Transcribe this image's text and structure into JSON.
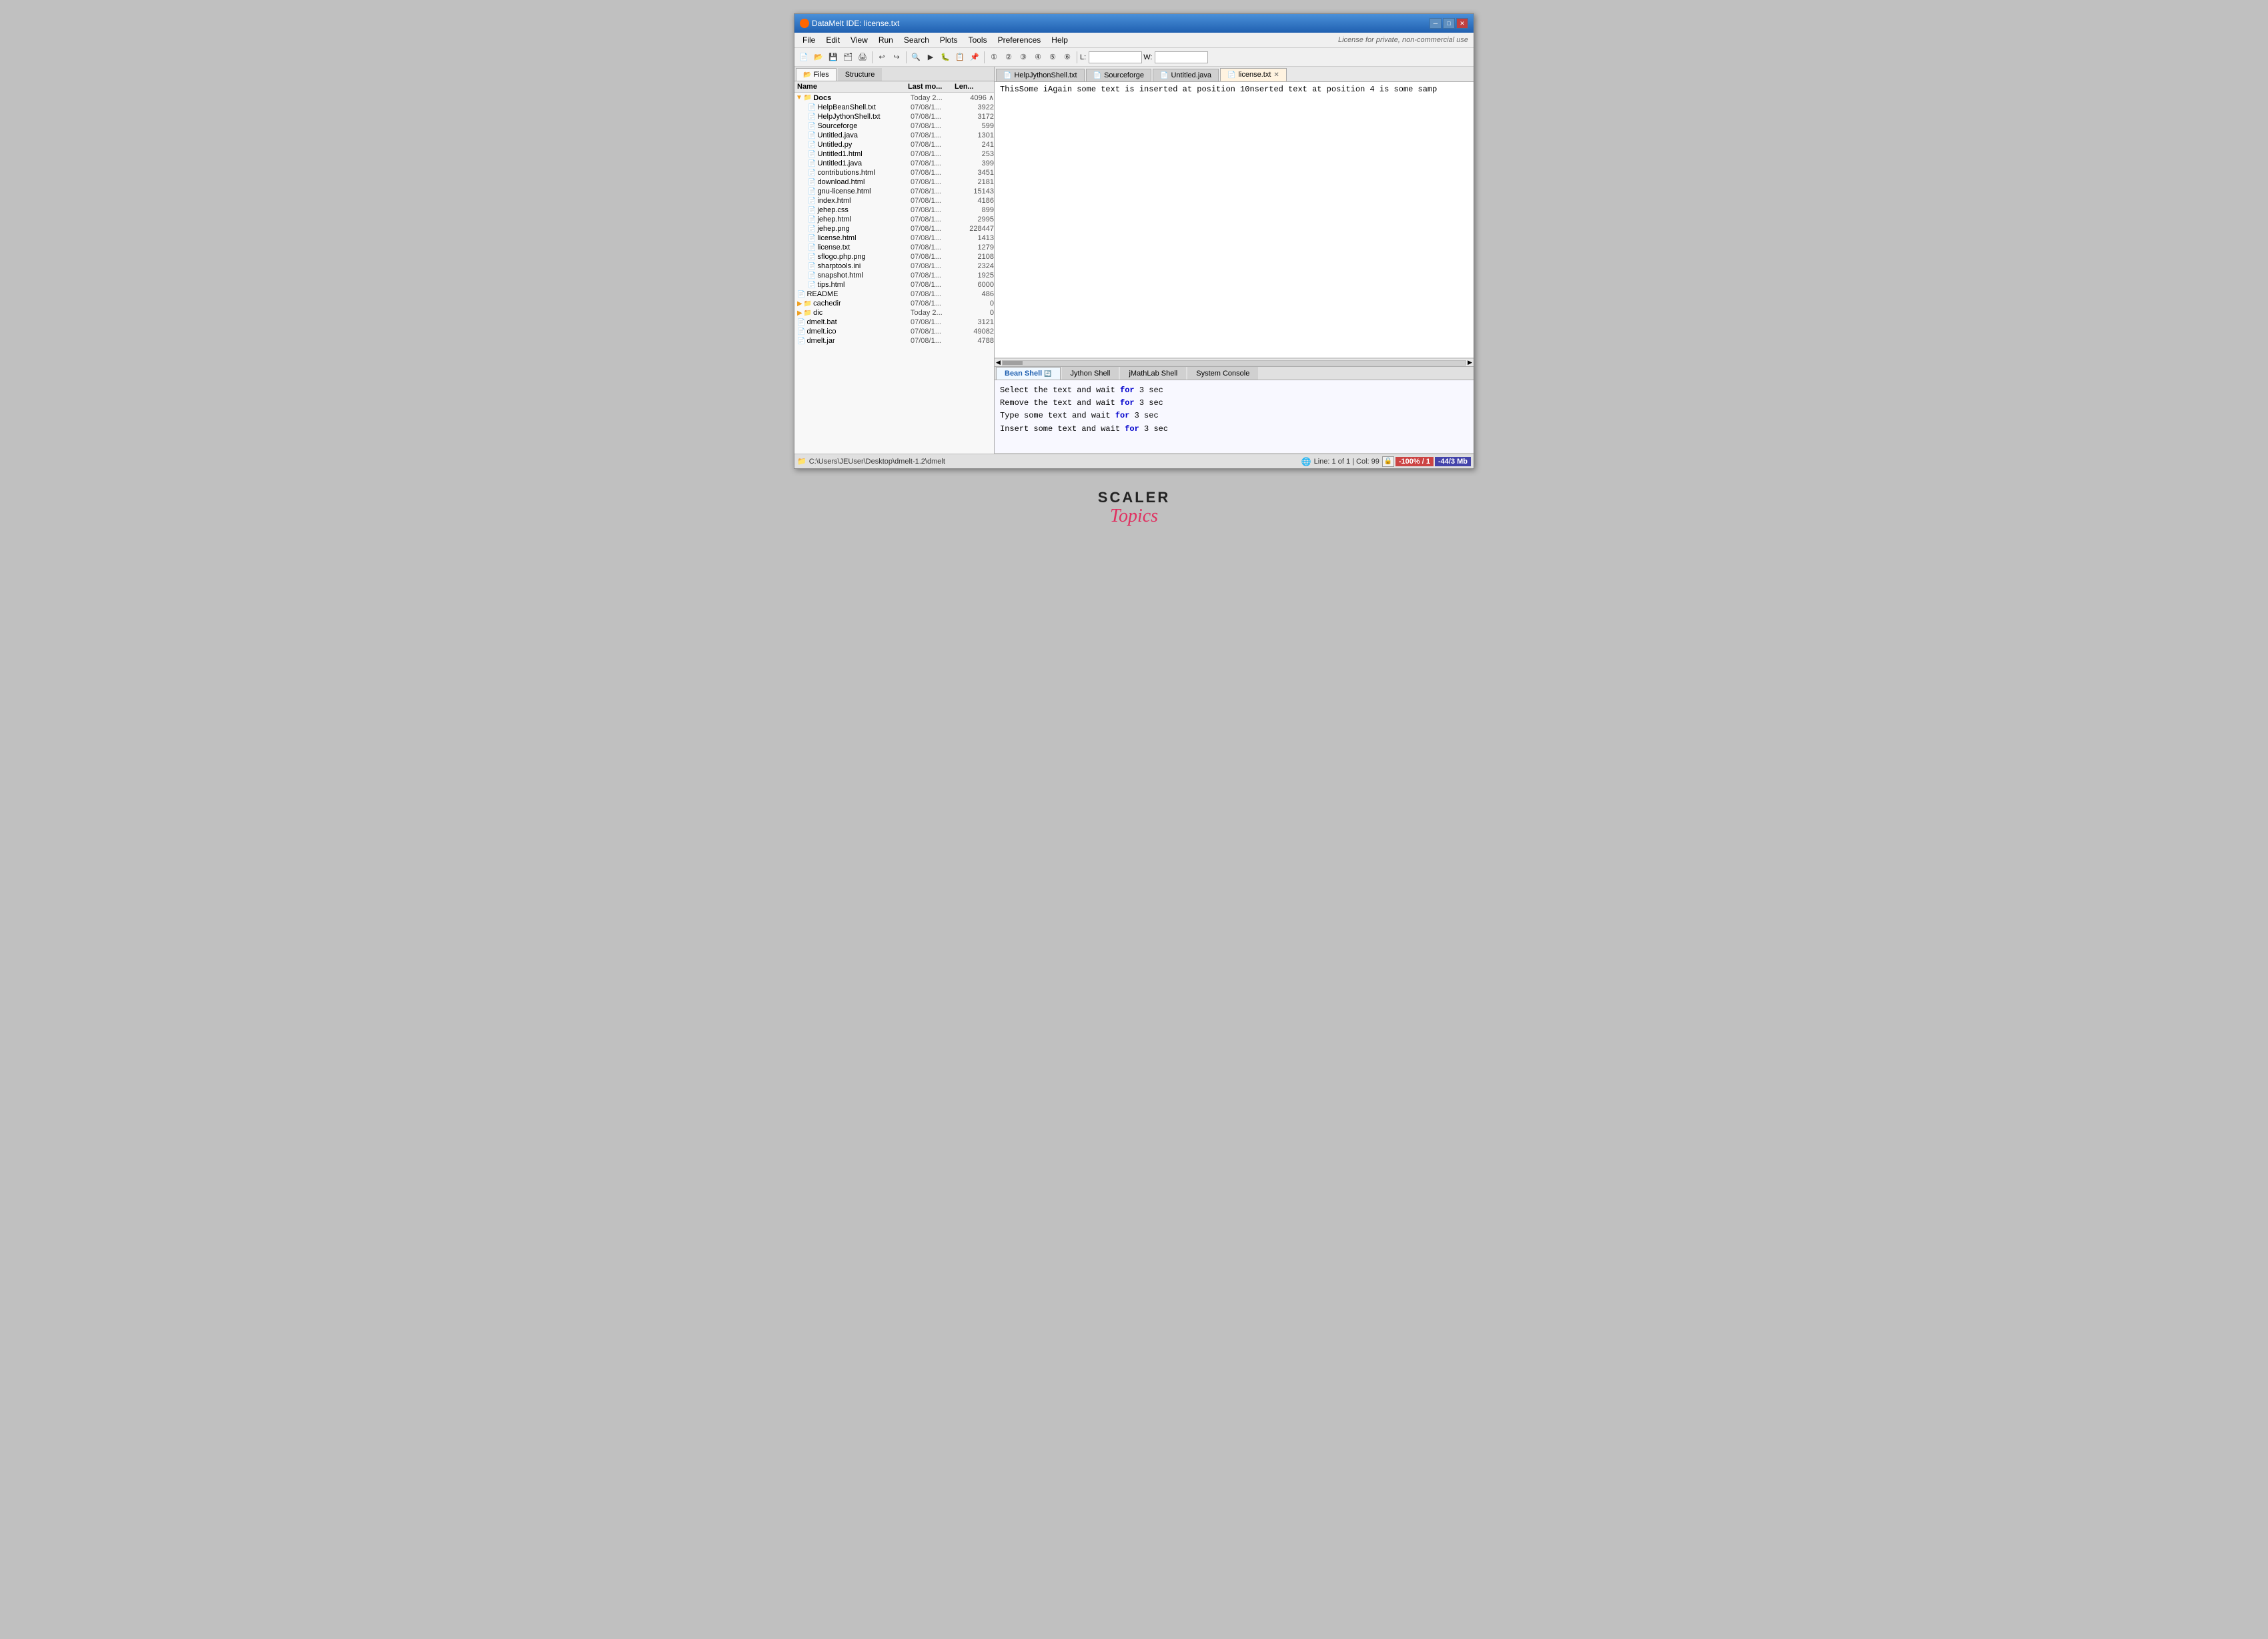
{
  "window": {
    "title": "DataMelt IDE: license.txt",
    "icon": "●",
    "min_btn": "─",
    "max_btn": "□",
    "close_btn": "✕"
  },
  "menu": {
    "items": [
      "File",
      "Edit",
      "View",
      "Run",
      "Search",
      "Plots",
      "Tools",
      "Preferences",
      "Help"
    ],
    "license_note": "License for private, non-commercial use"
  },
  "toolbar": {
    "label_L": "L:",
    "label_W": "W:"
  },
  "left_panel": {
    "tabs": [
      {
        "label": "Files",
        "active": true,
        "icon": "📂"
      },
      {
        "label": "Structure",
        "active": false
      }
    ],
    "tree_headers": {
      "name": "Name",
      "last_mod": "Last mo...",
      "length": "Len..."
    },
    "tree_items": [
      {
        "indent": 0,
        "type": "folder",
        "name": "Docs",
        "date": "Today 2...",
        "size": "4096",
        "expanded": true
      },
      {
        "indent": 1,
        "type": "file",
        "name": "HelpBeanShell.txt",
        "date": "07/08/1...",
        "size": "3922"
      },
      {
        "indent": 1,
        "type": "file",
        "name": "HelpJythonShell.txt",
        "date": "07/08/1...",
        "size": "3172"
      },
      {
        "indent": 1,
        "type": "file",
        "name": "Sourceforge",
        "date": "07/08/1...",
        "size": "599"
      },
      {
        "indent": 1,
        "type": "file",
        "name": "Untitled.java",
        "date": "07/08/1...",
        "size": "1301"
      },
      {
        "indent": 1,
        "type": "file",
        "name": "Untitled.py",
        "date": "07/08/1...",
        "size": "241"
      },
      {
        "indent": 1,
        "type": "file",
        "name": "Untitled1.html",
        "date": "07/08/1...",
        "size": "253"
      },
      {
        "indent": 1,
        "type": "file",
        "name": "Untitled1.java",
        "date": "07/08/1...",
        "size": "399"
      },
      {
        "indent": 1,
        "type": "file",
        "name": "contributions.html",
        "date": "07/08/1...",
        "size": "3451"
      },
      {
        "indent": 1,
        "type": "file",
        "name": "download.html",
        "date": "07/08/1...",
        "size": "2181"
      },
      {
        "indent": 1,
        "type": "file",
        "name": "gnu-license.html",
        "date": "07/08/1...",
        "size": "15143"
      },
      {
        "indent": 1,
        "type": "file",
        "name": "index.html",
        "date": "07/08/1...",
        "size": "4186"
      },
      {
        "indent": 1,
        "type": "file",
        "name": "jehep.css",
        "date": "07/08/1...",
        "size": "899"
      },
      {
        "indent": 1,
        "type": "file",
        "name": "jehep.html",
        "date": "07/08/1...",
        "size": "2995"
      },
      {
        "indent": 1,
        "type": "file",
        "name": "jehep.png",
        "date": "07/08/1...",
        "size": "228447"
      },
      {
        "indent": 1,
        "type": "file",
        "name": "license.html",
        "date": "07/08/1...",
        "size": "1413"
      },
      {
        "indent": 1,
        "type": "file",
        "name": "license.txt",
        "date": "07/08/1...",
        "size": "1279"
      },
      {
        "indent": 1,
        "type": "file",
        "name": "sflogo.php.png",
        "date": "07/08/1...",
        "size": "2108"
      },
      {
        "indent": 1,
        "type": "file",
        "name": "sharptools.ini",
        "date": "07/08/1...",
        "size": "2324"
      },
      {
        "indent": 1,
        "type": "file",
        "name": "snapshot.html",
        "date": "07/08/1...",
        "size": "1925"
      },
      {
        "indent": 1,
        "type": "file",
        "name": "tips.html",
        "date": "07/08/1...",
        "size": "6000"
      },
      {
        "indent": 0,
        "type": "file",
        "name": "README",
        "date": "07/08/1...",
        "size": "486"
      },
      {
        "indent": 0,
        "type": "folder",
        "name": "cachedir",
        "date": "07/08/1...",
        "size": "0",
        "expanded": false
      },
      {
        "indent": 0,
        "type": "folder",
        "name": "dic",
        "date": "Today 2...",
        "size": "0",
        "expanded": false
      },
      {
        "indent": 0,
        "type": "file",
        "name": "dmelt.bat",
        "date": "07/08/1...",
        "size": "3121"
      },
      {
        "indent": 0,
        "type": "file",
        "name": "dmelt.ico",
        "date": "07/08/1...",
        "size": "49082"
      },
      {
        "indent": 0,
        "type": "file",
        "name": "dmelt.jar",
        "date": "07/08/1...",
        "size": "4788"
      }
    ]
  },
  "editor": {
    "tabs": [
      {
        "label": "HelpJythonShell.txt",
        "active": false,
        "icon": "📄",
        "closeable": false
      },
      {
        "label": "Sourceforge",
        "active": false,
        "icon": "📄",
        "closeable": false
      },
      {
        "label": "Untitled.java",
        "active": false,
        "icon": "📄",
        "closeable": false
      },
      {
        "label": "license.txt",
        "active": true,
        "icon": "📄",
        "closeable": true
      }
    ],
    "content": "ThisSome iAgain some text is  inserted at position 10nserted text at position 4 is some samp"
  },
  "shell": {
    "tabs": [
      {
        "label": "Bean Shell",
        "active": true,
        "has_refresh": true
      },
      {
        "label": "Jython Shell",
        "active": false
      },
      {
        "label": "jMathLab Shell",
        "active": false
      },
      {
        "label": "System Console",
        "active": false
      }
    ],
    "lines": [
      {
        "text": "Select the text and wait for 3 sec",
        "highlight": "for"
      },
      {
        "text": "Remove the text and wait for 3 sec",
        "highlight": "for"
      },
      {
        "text": "Type some text and wait for 3 sec",
        "highlight": "for"
      },
      {
        "text": "Insert some text and wait for 3 sec",
        "highlight": "for"
      }
    ]
  },
  "status_bar": {
    "path": "C:\\Users\\JEUser\\Desktop\\dmelt-1.2\\dmelt",
    "line_info": "Line: 1 of 1 | Col: 99",
    "zoom": "-100% / 1",
    "memory": "-44/3 Mb"
  },
  "watermark": {
    "line1": "SCALER",
    "line2": "Topics"
  }
}
